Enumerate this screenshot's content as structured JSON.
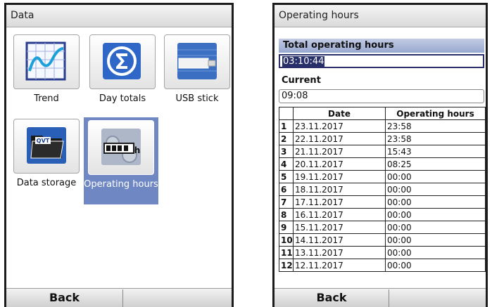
{
  "left_screen": {
    "title": "Data",
    "tiles": [
      {
        "label": "Trend",
        "icon": "trend-chart-icon",
        "selected": false
      },
      {
        "label": "Day totals",
        "icon": "sigma-icon",
        "selected": false
      },
      {
        "label": "USB stick",
        "icon": "usb-stick-icon",
        "selected": false
      },
      {
        "label": "Data storage",
        "icon": "folder-icon",
        "selected": false
      },
      {
        "label": "Operating hours",
        "icon": "hour-counter-icon",
        "selected": true
      }
    ],
    "softkeys": {
      "back": "Back",
      "right": ""
    }
  },
  "right_screen": {
    "title": "Operating hours",
    "total_label": "Total operating hours",
    "total_value": "03:10:44",
    "current_label": "Current",
    "current_value": "09:08",
    "table": {
      "headers": [
        "",
        "Date",
        "Operating hours"
      ],
      "rows": [
        {
          "index": "1",
          "date": "23.11.2017",
          "hours": "23:58"
        },
        {
          "index": "2",
          "date": "22.11.2017",
          "hours": "23:58"
        },
        {
          "index": "3",
          "date": "21.11.2017",
          "hours": "15:43"
        },
        {
          "index": "4",
          "date": "20.11.2017",
          "hours": "08:25"
        },
        {
          "index": "5",
          "date": "19.11.2017",
          "hours": "00:00"
        },
        {
          "index": "6",
          "date": "18.11.2017",
          "hours": "00:00"
        },
        {
          "index": "7",
          "date": "17.11.2017",
          "hours": "00:00"
        },
        {
          "index": "8",
          "date": "16.11.2017",
          "hours": "00:00"
        },
        {
          "index": "9",
          "date": "15.11.2017",
          "hours": "00:00"
        },
        {
          "index": "10",
          "date": "14.11.2017",
          "hours": "00:00"
        },
        {
          "index": "11",
          "date": "13.11.2017",
          "hours": "00:00"
        },
        {
          "index": "12",
          "date": "12.11.2017",
          "hours": "00:00"
        }
      ]
    },
    "softkeys": {
      "back": "Back",
      "right": ""
    }
  },
  "colors": {
    "selection": "#6f88c4",
    "header_band": "#98a8d0",
    "text_selection": "#28306a"
  }
}
